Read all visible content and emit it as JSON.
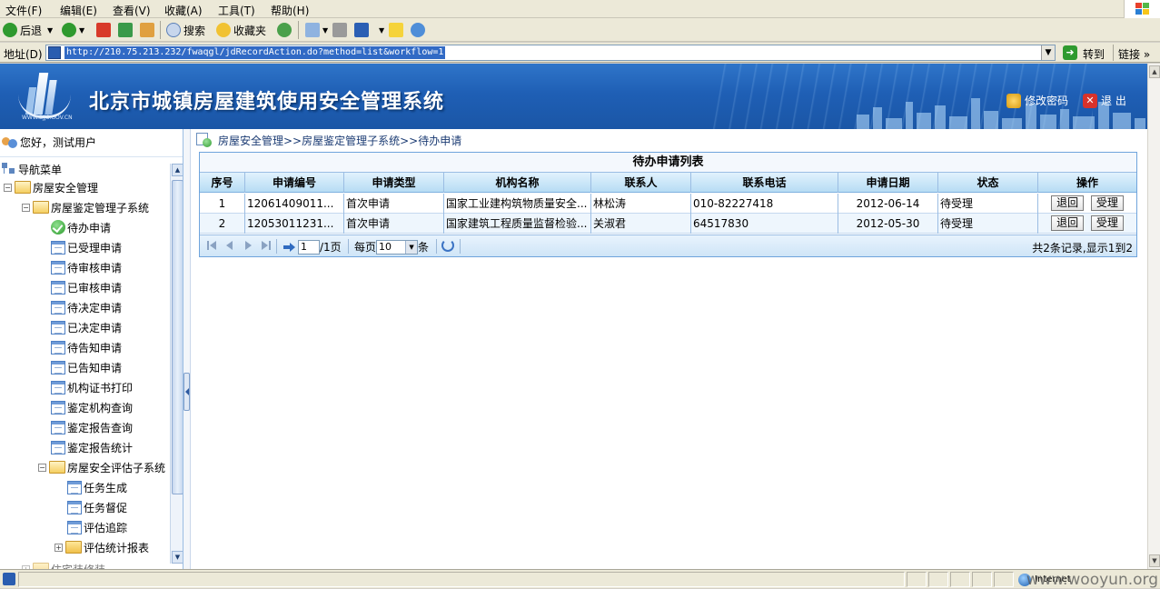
{
  "menu": [
    "文件(F)",
    "编辑(E)",
    "查看(V)",
    "收藏(A)",
    "工具(T)",
    "帮助(H)"
  ],
  "toolbar": {
    "back": "后退",
    "search": "搜索",
    "favorites": "收藏夹"
  },
  "address": {
    "label": "地址(D)",
    "url": "http://210.75.213.232/fwaqgl/jdRecordAction.do?method=list&workflow=1",
    "go": "转到",
    "links": "链接"
  },
  "header": {
    "logo_text": "WWW.BJJS.GOV.CN",
    "title": "北京市城镇房屋建筑使用安全管理系统",
    "change_password": "修改密码",
    "logout": "退 出"
  },
  "nav": {
    "greeting": "您好，测试用户",
    "menu_title": "导航菜单",
    "root": "房屋安全管理",
    "subsystem1": "房屋鉴定管理子系统",
    "items1": [
      "待办申请",
      "已受理申请",
      "待审核申请",
      "已审核申请",
      "待决定申请",
      "已决定申请",
      "待告知申请",
      "已告知申请",
      "机构证书打印",
      "鉴定机构查询",
      "鉴定报告查询",
      "鉴定报告统计"
    ],
    "subsystem2": "房屋安全评估子系统",
    "items2": [
      "任务生成",
      "任务督促",
      "评估追踪"
    ],
    "subsystem2_child": "评估统计报表",
    "cut_off_item": "住宅装修装..."
  },
  "breadcrumb": "房屋安全管理>>房屋鉴定管理子系统>>待办申请",
  "grid": {
    "title": "待办申请列表",
    "columns": [
      "序号",
      "申请编号",
      "申请类型",
      "机构名称",
      "联系人",
      "联系电话",
      "申请日期",
      "状态",
      "操作"
    ],
    "rows": [
      {
        "no": "1",
        "code": "12061409011...",
        "type": "首次申请",
        "org": "国家工业建构筑物质量安全...",
        "contact": "林松涛",
        "phone": "010-82227418",
        "date": "2012-06-14",
        "status": "待受理"
      },
      {
        "no": "2",
        "code": "12053011231...",
        "type": "首次申请",
        "org": "国家建筑工程质量监督检验...",
        "contact": "关淑君",
        "phone": "64517830",
        "date": "2012-05-30",
        "status": "待受理"
      }
    ],
    "action_return": "退回",
    "action_accept": "受理",
    "pager": {
      "page": "1",
      "page_total": "/1页",
      "per_page_label": "每页",
      "per_page_value": "10",
      "per_page_unit": "条",
      "summary": "共2条记录,显示1到2"
    }
  },
  "status": {
    "zone": "Internet",
    "watermark": "www.wooyun.org"
  },
  "colors": {
    "banner": "#1f5fb5",
    "grid_border": "#6fa4dc",
    "header_row": "#b7dcf4"
  }
}
